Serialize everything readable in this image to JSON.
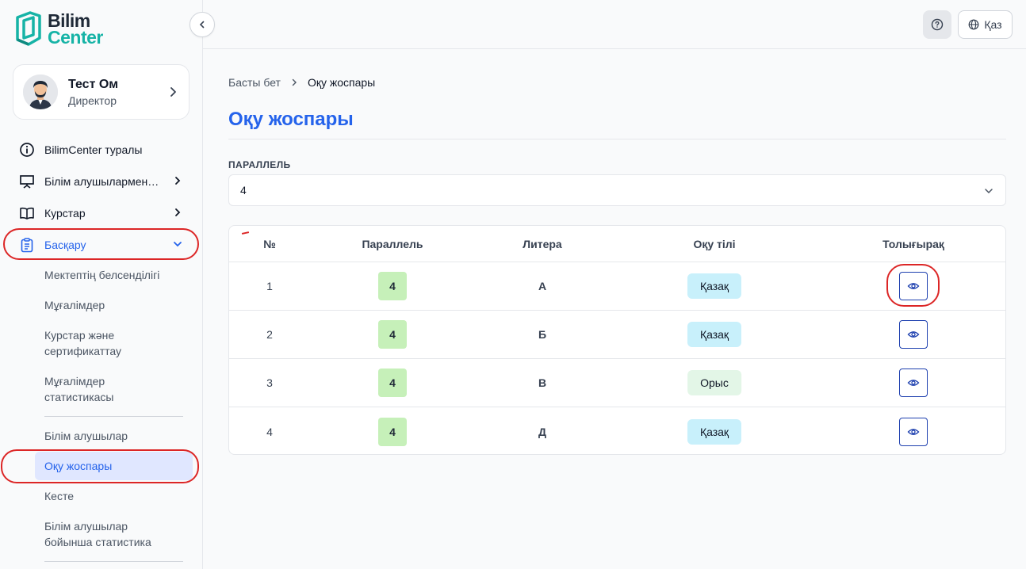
{
  "brand": {
    "line1": "Bilim",
    "line2": "Center"
  },
  "profile": {
    "name": "Тест Ом",
    "role": "Директор"
  },
  "nav": {
    "about": "BilimCenter туралы",
    "students": "Білім алушылармен жұмыс",
    "courses": "Курстар",
    "manage": "Басқару"
  },
  "sub": {
    "activity": "Мектептің белсенділігі",
    "teachers": "Мұғалімдер",
    "courses_cert": "Курстар және сертификаттау",
    "teacher_stats": "Мұғалімдер статистикасы",
    "students": "Білім алушылар",
    "study_plan": "Оқу жоспары",
    "schedule": "Кесте",
    "student_stats": "Білім алушылар бойынша статистика"
  },
  "top": {
    "lang": "Қаз"
  },
  "breadcrumb": {
    "home": "Басты бет",
    "current": "Оқу жоспары"
  },
  "page": {
    "title": "Оқу жоспары"
  },
  "filter": {
    "label": "ПАРАЛЛЕЛЬ",
    "value": "4"
  },
  "table": {
    "headers": {
      "num": "№",
      "parallel": "Параллель",
      "letter": "Литера",
      "lang": "Оқу тілі",
      "more": "Толығырақ"
    },
    "rows": [
      {
        "num": "1",
        "parallel": "4",
        "letter": "А",
        "lang": "Қазақ"
      },
      {
        "num": "2",
        "parallel": "4",
        "letter": "Б",
        "lang": "Қазақ"
      },
      {
        "num": "3",
        "parallel": "4",
        "letter": "В",
        "lang": "Орыс"
      },
      {
        "num": "4",
        "parallel": "4",
        "letter": "Д",
        "lang": "Қазақ"
      }
    ]
  },
  "colors": {
    "accent": "#2563eb",
    "highlight": "#dc2626",
    "brand_teal": "#16b3a6"
  }
}
